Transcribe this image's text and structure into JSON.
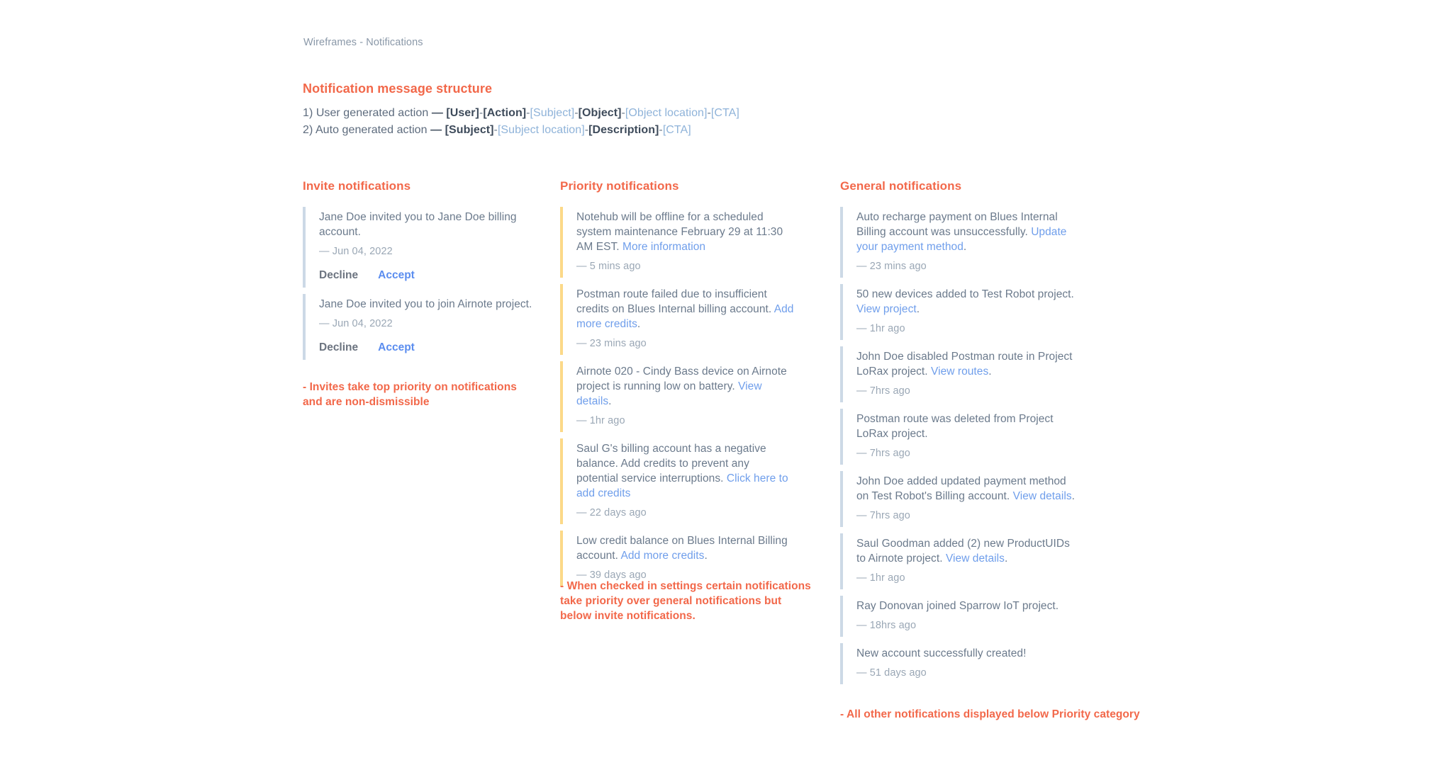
{
  "breadcrumb": "Wireframes - Notifications",
  "colors": {
    "accent_red": "#f2684a",
    "link_blue": "#6f9eeb",
    "bar_invite": "#ccd9e6",
    "bar_priority": "#fcd988",
    "bar_general": "#ccd9e6",
    "body_text": "#6b7a8c",
    "muted_text": "#9aa7b5"
  },
  "structure": {
    "title": "Notification message structure",
    "lines": [
      {
        "index": "1)",
        "lead": "User generated action",
        "dash": "—",
        "tokens": [
          {
            "text": "[User]",
            "style": "dark"
          },
          {
            "text": "[Action]",
            "style": "dark"
          },
          {
            "text": "[Subject]",
            "style": "light"
          },
          {
            "text": "[Object]",
            "style": "dark"
          },
          {
            "text": "[Object location]",
            "style": "light"
          },
          {
            "text": "[CTA]",
            "style": "light"
          }
        ]
      },
      {
        "index": "2)",
        "lead": "Auto generated action",
        "dash": "—",
        "tokens": [
          {
            "text": "[Subject]",
            "style": "dark"
          },
          {
            "text": "[Subject location]",
            "style": "light"
          },
          {
            "text": "[Description]",
            "style": "dark"
          },
          {
            "text": "[CTA]",
            "style": "light"
          }
        ]
      }
    ]
  },
  "columns": {
    "invite": {
      "title": "Invite notifications",
      "annotation": "- Invites take top priority on notifications and are non-dismissible",
      "items": [
        {
          "segments": [
            {
              "text": "Jane Doe invited you to Jane Doe billing account.",
              "link": false
            }
          ],
          "time": "— Jun 04, 2022",
          "actions": {
            "decline": "Decline",
            "accept": "Accept"
          }
        },
        {
          "segments": [
            {
              "text": "Jane Doe invited you to join Airnote project.",
              "link": false
            }
          ],
          "time": "— Jun 04, 2022",
          "actions": {
            "decline": "Decline",
            "accept": "Accept"
          }
        }
      ]
    },
    "priority": {
      "title": "Priority notifications",
      "annotation": "- When checked in settings certain notifications take priority over general notifications but below invite notifications.",
      "items": [
        {
          "segments": [
            {
              "text": "Notehub will be offline for a scheduled system maintenance February 29 at 11:30 AM EST. ",
              "link": false
            },
            {
              "text": "More information",
              "link": true
            }
          ],
          "time": "— 5 mins ago"
        },
        {
          "segments": [
            {
              "text": "Postman route failed due to insufficient credits on Blues Internal billing account. ",
              "link": false
            },
            {
              "text": "Add more credits",
              "link": true
            },
            {
              "text": ".",
              "link": false
            }
          ],
          "time": "— 23 mins ago"
        },
        {
          "segments": [
            {
              "text": "Airnote 020 - Cindy Bass device on Airnote project is running low on battery. ",
              "link": false
            },
            {
              "text": "View details",
              "link": true
            },
            {
              "text": ".",
              "link": false
            }
          ],
          "time": "— 1hr ago"
        },
        {
          "segments": [
            {
              "text": "Saul G's billing account has a negative balance. Add credits to prevent any potential service interruptions. ",
              "link": false
            },
            {
              "text": "Click here to add credits",
              "link": true
            }
          ],
          "time": "— 22 days ago"
        },
        {
          "segments": [
            {
              "text": "Low credit balance on Blues Internal Billing account. ",
              "link": false
            },
            {
              "text": "Add more credits",
              "link": true
            },
            {
              "text": ".",
              "link": false
            }
          ],
          "time": "— 39 days ago"
        }
      ]
    },
    "general": {
      "title": "General notifications",
      "annotation": "- All other notifications displayed below Priority category",
      "items": [
        {
          "segments": [
            {
              "text": "Auto recharge payment on Blues Internal Billing account was unsuccessfully. ",
              "link": false
            },
            {
              "text": "Update your payment method",
              "link": true
            },
            {
              "text": ".",
              "link": false
            }
          ],
          "time": "— 23 mins ago"
        },
        {
          "segments": [
            {
              "text": "50 new devices added to Test Robot project. ",
              "link": false
            },
            {
              "text": "View project",
              "link": true
            },
            {
              "text": ".",
              "link": false
            }
          ],
          "time": "— 1hr ago"
        },
        {
          "segments": [
            {
              "text": "John Doe disabled Postman route in Project LoRax project. ",
              "link": false
            },
            {
              "text": "View routes",
              "link": true
            },
            {
              "text": ".",
              "link": false
            }
          ],
          "time": "— 7hrs ago"
        },
        {
          "segments": [
            {
              "text": "Postman route was deleted from Project LoRax project.",
              "link": false
            }
          ],
          "time": "— 7hrs ago"
        },
        {
          "segments": [
            {
              "text": "John Doe added updated payment method on Test Robot's Billing account. ",
              "link": false
            },
            {
              "text": "View details",
              "link": true
            },
            {
              "text": ".",
              "link": false
            }
          ],
          "time": "— 7hrs ago"
        },
        {
          "segments": [
            {
              "text": "Saul Goodman added (2) new ProductUIDs to Airnote project. ",
              "link": false
            },
            {
              "text": "View details",
              "link": true
            },
            {
              "text": ".",
              "link": false
            }
          ],
          "time": "— 1hr ago"
        },
        {
          "segments": [
            {
              "text": "Ray Donovan joined Sparrow IoT project.",
              "link": false
            }
          ],
          "time": "— 18hrs ago"
        },
        {
          "segments": [
            {
              "text": "New account successfully created!",
              "link": false
            }
          ],
          "time": "— 51 days ago"
        }
      ]
    }
  }
}
